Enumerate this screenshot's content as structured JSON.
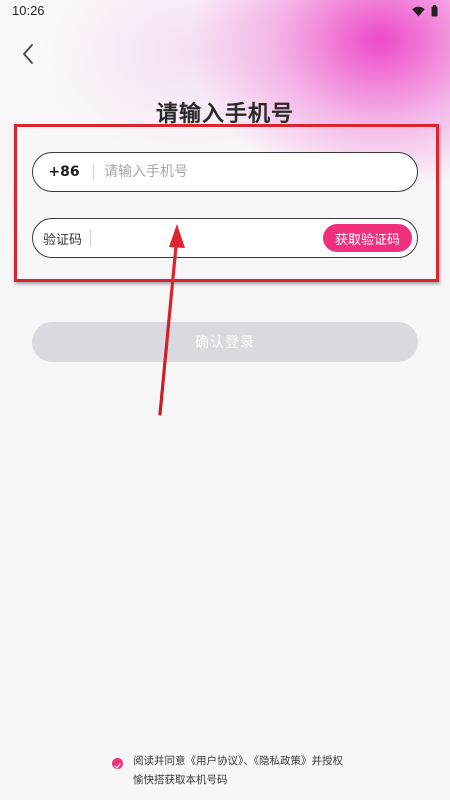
{
  "status_bar": {
    "time": "10:26",
    "icons": [
      "wifi-icon",
      "battery-icon"
    ]
  },
  "nav": {
    "back_icon": "chevron-left-icon"
  },
  "page": {
    "title": "请输入手机号"
  },
  "phone": {
    "country_code": "+86",
    "placeholder": "请输入手机号",
    "value": ""
  },
  "verification": {
    "label": "验证码",
    "value": "",
    "get_code_label": "获取验证码"
  },
  "confirm": {
    "label": "确认登录"
  },
  "agreement": {
    "prefix": "阅读并同意",
    "user_agreement": "《用户协议》",
    "separator": "、",
    "privacy_policy": "《隐私政策》",
    "suffix": "并授权愉快搭获取本机号码",
    "checked": true
  },
  "colors": {
    "accent": "#f0307d",
    "annotation": "#d9252e",
    "disabled_button": "#d9d9df"
  }
}
